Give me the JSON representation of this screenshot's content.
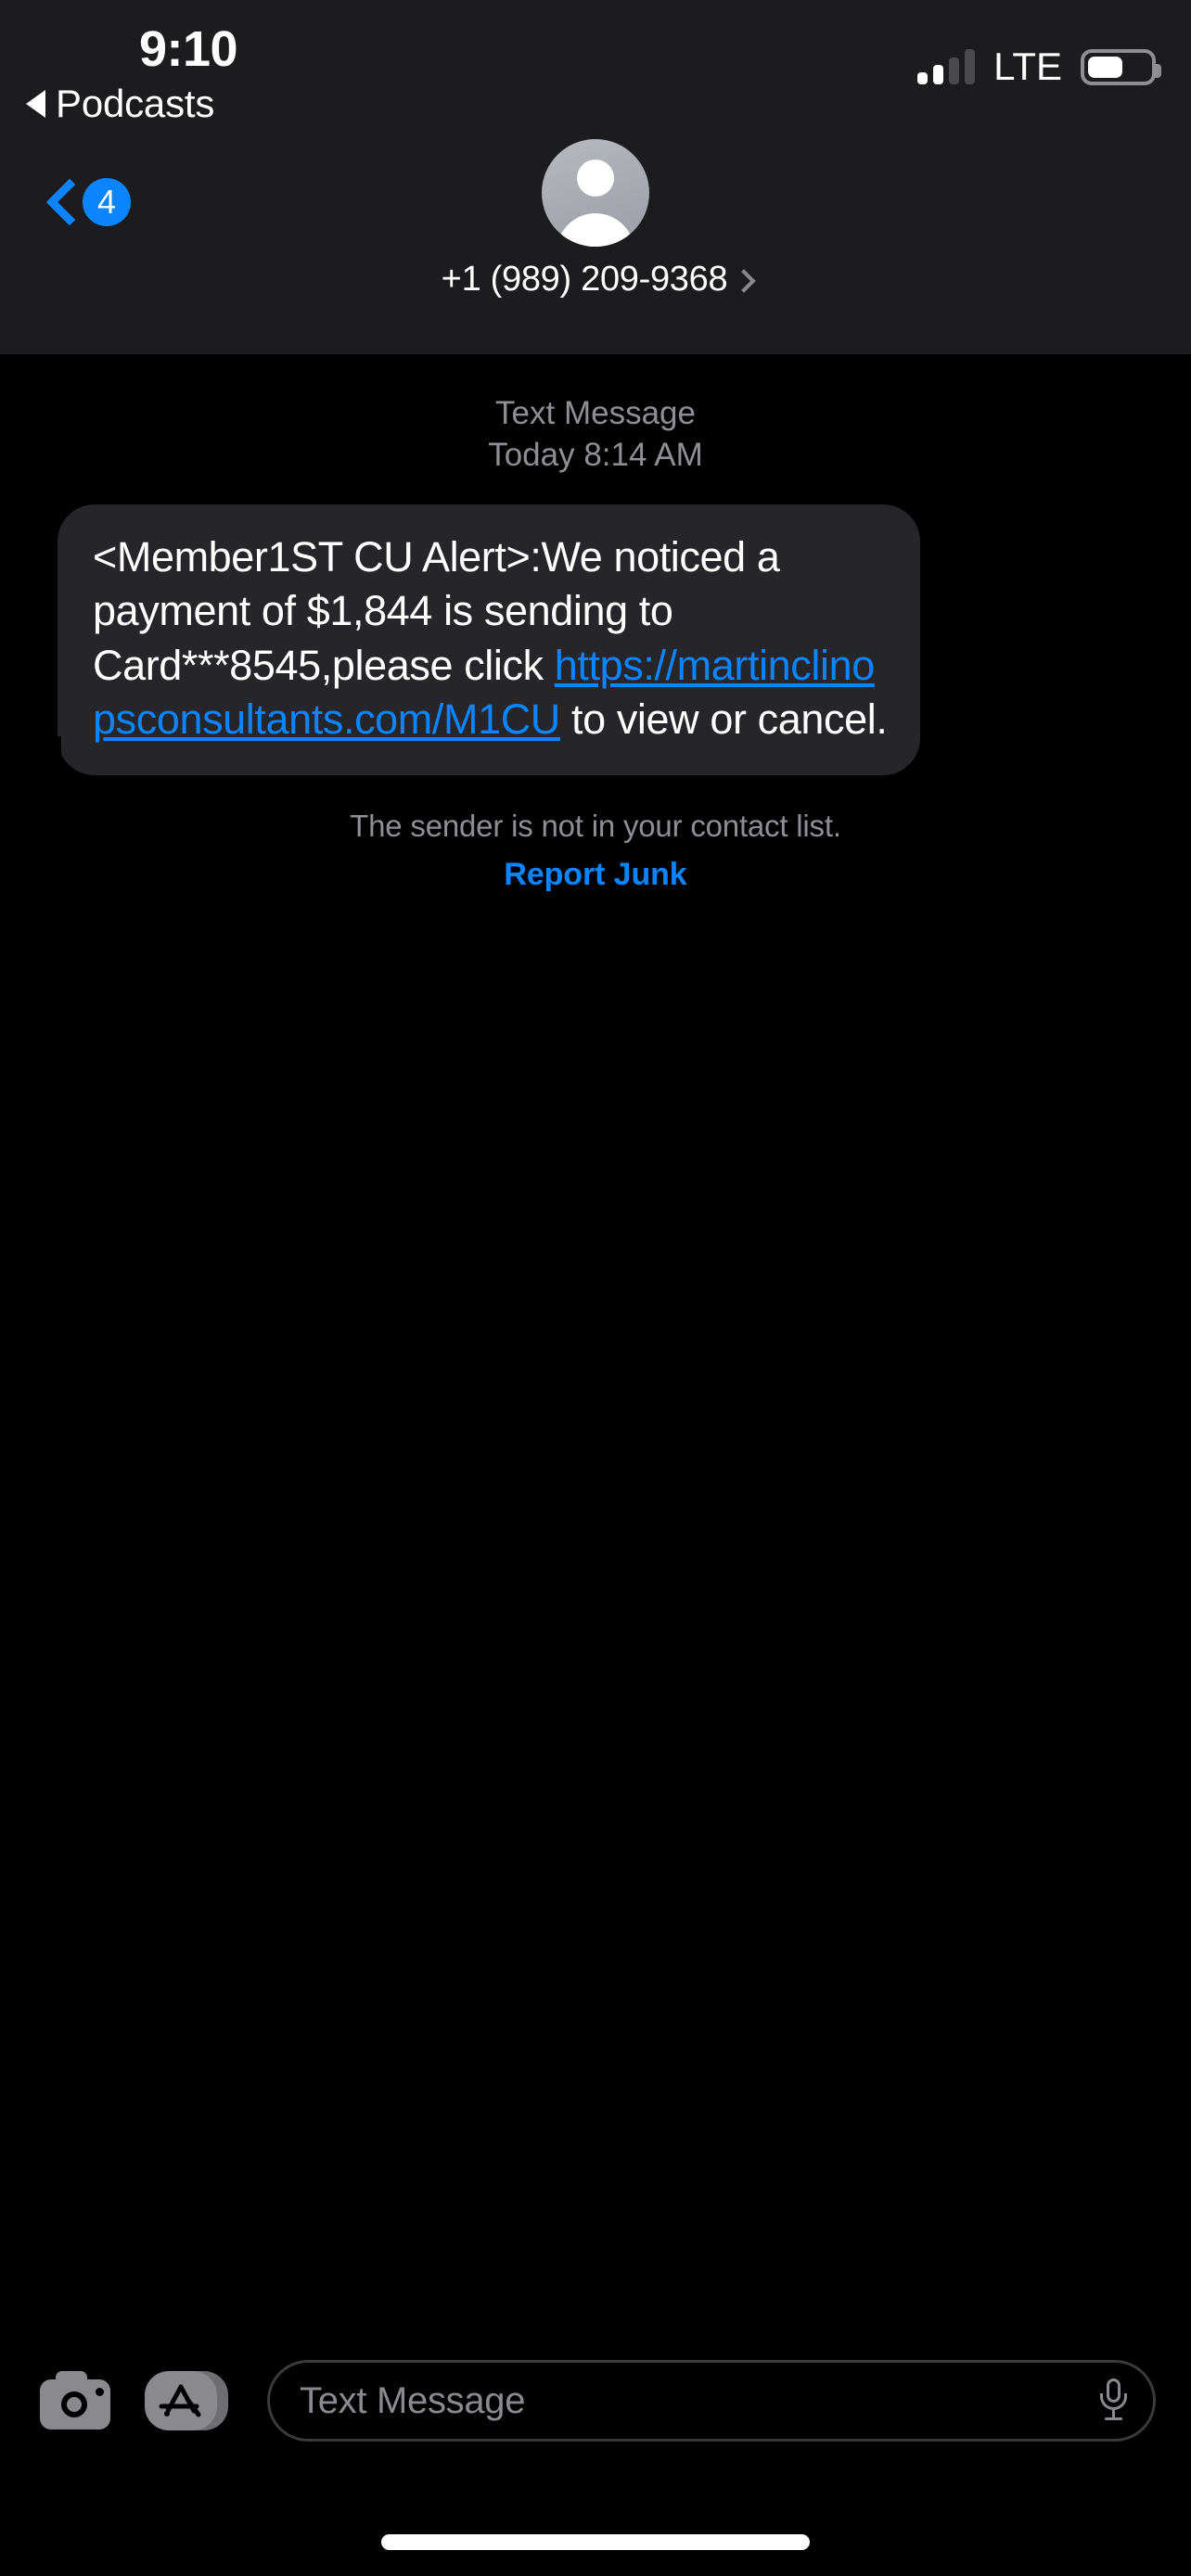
{
  "status_bar": {
    "time": "9:10",
    "return_to_app_label": "Podcasts",
    "carrier": "LTE",
    "signal_bars_filled": 2,
    "signal_bars_total": 4,
    "battery_percent": 50
  },
  "nav": {
    "unread_count": "4",
    "contact_number": "+1 (989) 209-9368"
  },
  "conversation": {
    "message_type_label": "Text Message",
    "message_timestamp": "Today 8:14 AM",
    "bubble": {
      "text_before_link": "<Member1ST CU Alert>:We noticed a payment of $1,844 is sending to Card***8545,please click ",
      "link_text": "https://martinclinopsconsultants.com/M1CU",
      "text_after_link": " to view or cancel."
    },
    "sender_note": "The sender is not in your contact list.",
    "report_junk_label": "Report Junk"
  },
  "input_bar": {
    "placeholder": "Text Message"
  },
  "colors": {
    "accent_blue": "#0a84ff",
    "navbar_background": "#1c1c1e",
    "bubble_background": "#26262a",
    "secondary_text": "#8e8e93",
    "screen_background": "#000000"
  }
}
